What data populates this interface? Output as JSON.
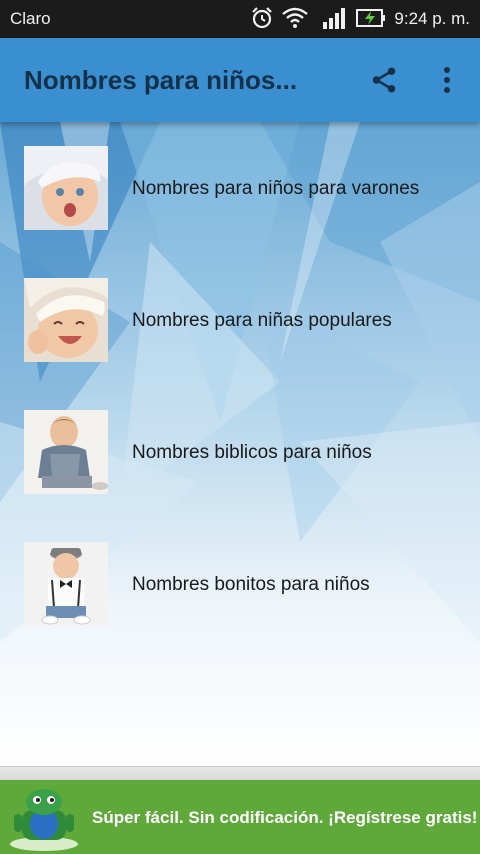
{
  "status_bar": {
    "carrier": "Claro",
    "time": "9:24 p. m.",
    "icons": [
      "alarm-icon",
      "wifi-icon",
      "signal-icon",
      "battery-charging-icon"
    ]
  },
  "app_bar": {
    "title": "Nombres para niños...",
    "color": "#3a8fd0",
    "actions": [
      "share-icon",
      "more-vert-icon"
    ]
  },
  "list": {
    "items": [
      {
        "label": "Nombres para niños para varones",
        "thumbnail": "baby-photo"
      },
      {
        "label": "Nombres para niñas populares",
        "thumbnail": "baby-photo"
      },
      {
        "label": "Nombres biblicos para niños",
        "thumbnail": "toddler-photo"
      },
      {
        "label": "Nombres bonitos para niños",
        "thumbnail": "toddler-photo"
      }
    ]
  },
  "ad": {
    "text": "Súper fácil. Sin codificación. ¡Regístrese gratis!",
    "color": "#5fa83a"
  }
}
